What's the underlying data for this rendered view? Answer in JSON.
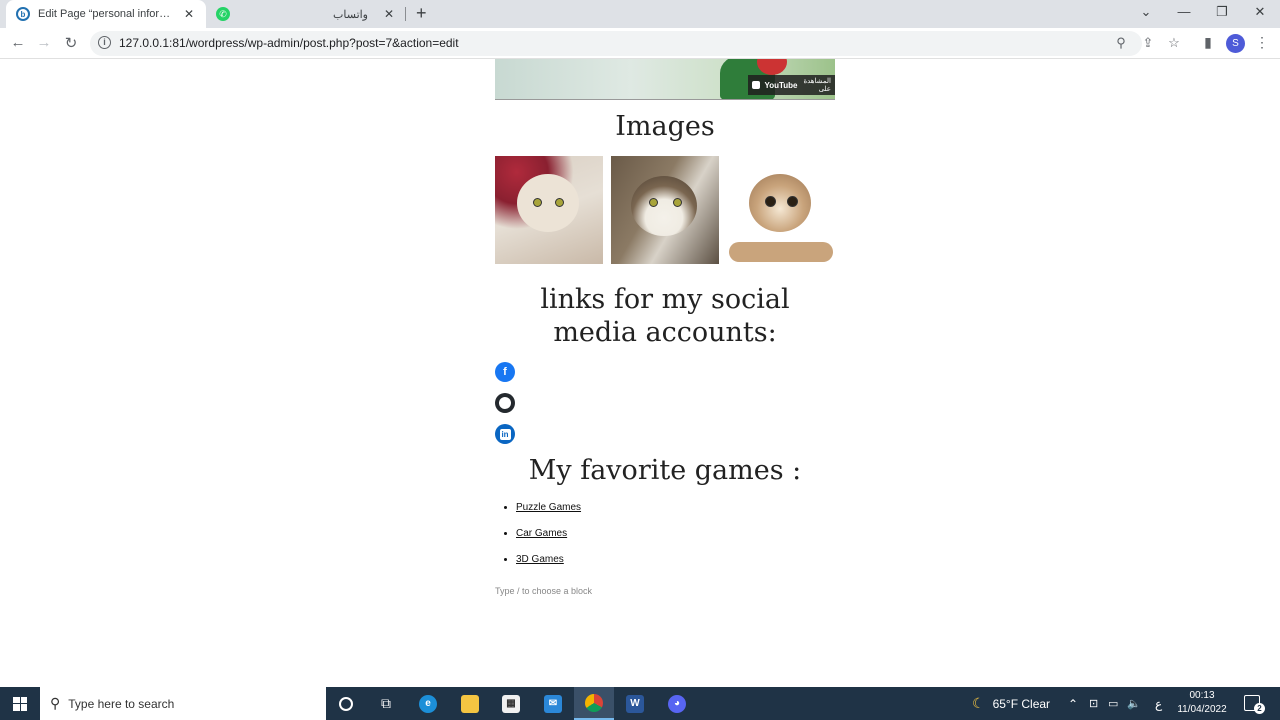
{
  "browser": {
    "tabs": [
      {
        "title": "Edit Page “personal information”",
        "favicon": "wordpress-icon",
        "active": true
      },
      {
        "title": "واتساب",
        "favicon": "whatsapp-icon",
        "active": false
      }
    ],
    "url": "127.0.0.1:81/wordpress/wp-admin/post.php?post=7&action=edit",
    "profile_initial": "S"
  },
  "page": {
    "video": {
      "youtube_label": "YouTube",
      "watch_label": "المشاهدة على"
    },
    "images_heading": "Images",
    "social_heading": "links for my social media accounts:",
    "social_icons": [
      "facebook-icon",
      "github-icon",
      "linkedin-icon"
    ],
    "games_heading": "My favorite games :",
    "games": [
      "Puzzle Games",
      "Car Games",
      "3D Games"
    ],
    "block_appender": "Type / to choose a block"
  },
  "taskbar": {
    "search_placeholder": "Type here to search",
    "weather": "65°F  Clear",
    "lang": "ع",
    "time": "00:13",
    "date": "11/04/2022",
    "notifications": "2"
  },
  "colors": {
    "facebook": "#1877f2",
    "github": "#24292e",
    "linkedin": "#0a66c2",
    "taskbar": "#1f3346"
  }
}
